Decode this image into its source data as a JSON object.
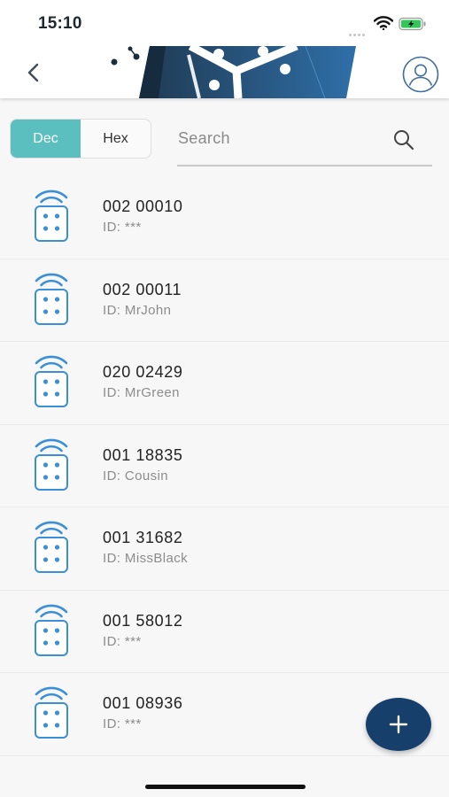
{
  "status_bar": {
    "time": "15:10"
  },
  "header": {
    "back_icon": "chevron-left-icon",
    "profile_icon": "user-circle-icon"
  },
  "toolbar": {
    "segment": [
      {
        "label": "Dec",
        "active": true
      },
      {
        "label": "Hex",
        "active": false
      }
    ],
    "search": {
      "placeholder": "Search",
      "value": ""
    }
  },
  "remotes": [
    {
      "number": "002 00010",
      "id": "ID: ***"
    },
    {
      "number": "002 00011",
      "id": "ID: MrJohn"
    },
    {
      "number": "020 02429",
      "id": "ID: MrGreen"
    },
    {
      "number": "001 18835",
      "id": "ID: Cousin"
    },
    {
      "number": "001 31682",
      "id": "ID: MissBlack"
    },
    {
      "number": "001 58012",
      "id": "ID: ***"
    },
    {
      "number": "001 08936",
      "id": "ID: ***"
    }
  ],
  "fab": {
    "icon": "plus-icon"
  },
  "colors": {
    "accent": "#5cbfbf",
    "fab": "#163f6b",
    "remote_icon": "#3a8fd6"
  }
}
